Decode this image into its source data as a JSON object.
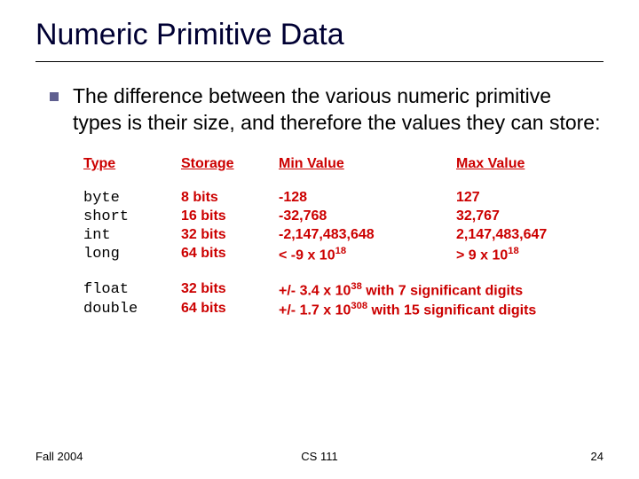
{
  "title": "Numeric Primitive Data",
  "bullet": "The difference between the various numeric primitive types is their size, and therefore the values they can store:",
  "headers": {
    "type": "Type",
    "storage": "Storage",
    "min": "Min Value",
    "max": "Max Value"
  },
  "integers": [
    {
      "type": "byte",
      "storage": "8 bits",
      "min": "-128",
      "max": "127"
    },
    {
      "type": "short",
      "storage": "16 bits",
      "min": "-32,768",
      "max": "32,767"
    },
    {
      "type": "int",
      "storage": "32 bits",
      "min": "-2,147,483,648",
      "max": "2,147,483,647"
    },
    {
      "type": "long",
      "storage": "64 bits",
      "min": "< -9 x 10",
      "min_exp": "18",
      "max": "> 9 x 10",
      "max_exp": "18"
    }
  ],
  "floats": [
    {
      "type": "float",
      "storage": "32 bits",
      "range_pre": "+/- 3.4 x 10",
      "range_exp": "38",
      "range_post": " with 7 significant digits"
    },
    {
      "type": "double",
      "storage": "64 bits",
      "range_pre": "+/- 1.7 x 10",
      "range_exp": "308",
      "range_post": " with 15 significant digits"
    }
  ],
  "footer": {
    "left": "Fall 2004",
    "center": "CS 111",
    "right": "24"
  }
}
